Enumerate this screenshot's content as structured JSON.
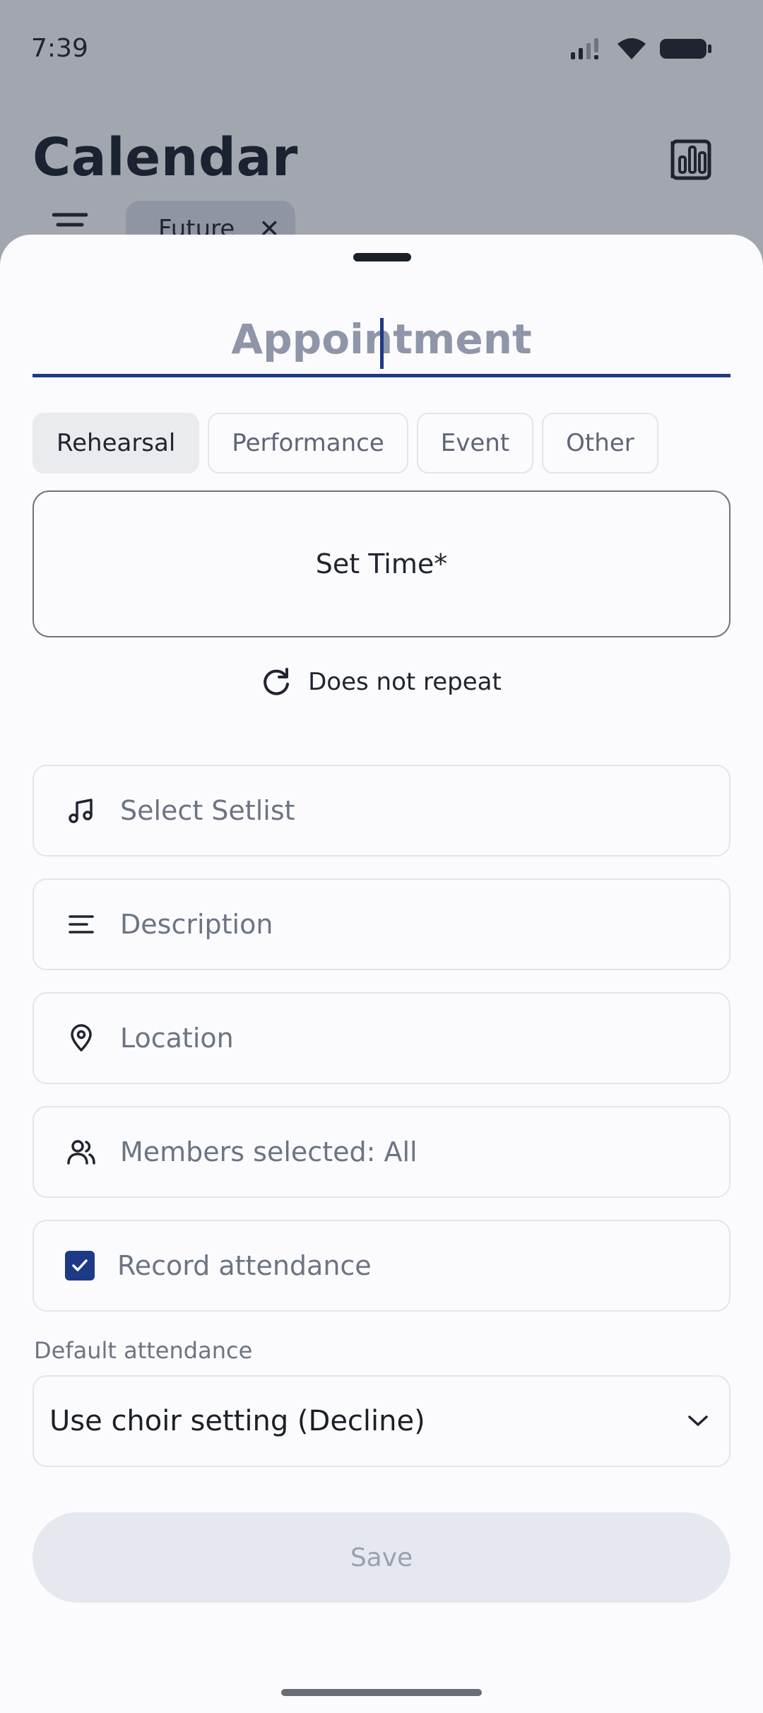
{
  "status_bar": {
    "time": "7:39"
  },
  "background": {
    "title": "Calendar",
    "filter_chip": "Future"
  },
  "form": {
    "title_placeholder": "Appointment",
    "types": [
      {
        "label": "Rehearsal",
        "active": true
      },
      {
        "label": "Performance",
        "active": false
      },
      {
        "label": "Event",
        "active": false
      },
      {
        "label": "Other",
        "active": false
      }
    ],
    "set_time_label": "Set Time*",
    "repeat_label": "Does not repeat",
    "fields": {
      "setlist": "Select Setlist",
      "description": "Description",
      "location": "Location",
      "members": "Members selected: All",
      "attendance": "Record attendance"
    },
    "record_attendance_checked": true,
    "default_attendance_label": "Default attendance",
    "default_attendance_value": "Use choir setting (Decline)",
    "save_label": "Save"
  },
  "colors": {
    "accent": "#1e3a86",
    "scrim": "#a2a6ae",
    "sheet": "#fbfbfd"
  }
}
